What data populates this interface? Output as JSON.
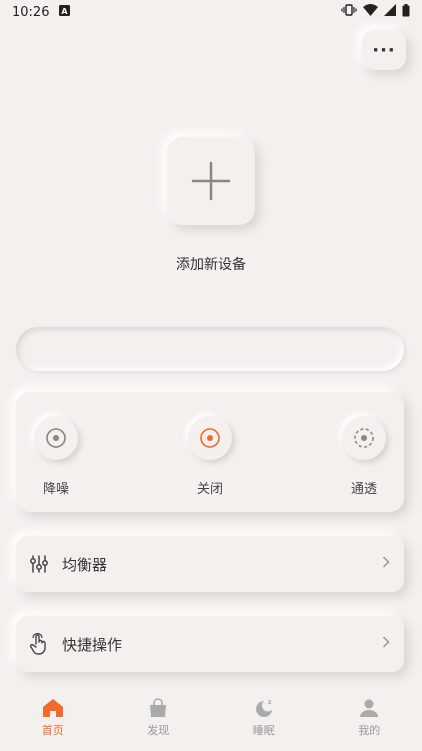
{
  "status": {
    "time": "10:26",
    "notification_icon": "notification-a-icon",
    "vibrate_icon": "vibrate-icon",
    "wifi_icon": "wifi-icon",
    "signal_icon": "signal-icon",
    "battery_icon": "battery-icon"
  },
  "header": {
    "more_label": "···"
  },
  "device": {
    "add_label": "添加新设备"
  },
  "modes": [
    {
      "label": "降噪",
      "icon": "noise-cancel-icon",
      "active": false
    },
    {
      "label": "关闭",
      "icon": "off-icon",
      "active": true
    },
    {
      "label": "通透",
      "icon": "transparency-icon",
      "active": false
    }
  ],
  "menu": {
    "equalizer_label": "均衡器",
    "shortcuts_label": "快捷操作"
  },
  "nav": [
    {
      "label": "首页",
      "icon": "home-icon",
      "active": true
    },
    {
      "label": "发现",
      "icon": "bag-icon",
      "active": false
    },
    {
      "label": "睡眠",
      "icon": "moon-icon",
      "active": false
    },
    {
      "label": "我的",
      "icon": "profile-icon",
      "active": false
    }
  ],
  "colors": {
    "accent": "#f06a2a",
    "background": "#f3f0ee",
    "inactive": "#999999"
  }
}
